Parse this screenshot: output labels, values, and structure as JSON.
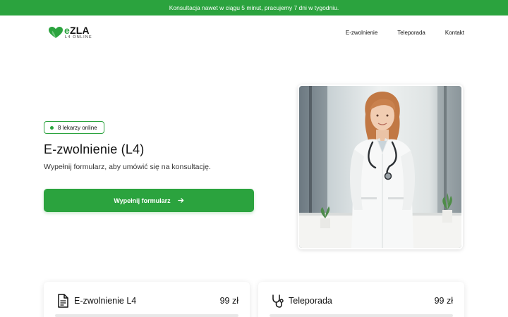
{
  "topbar": {
    "text": "Konsultacja nawet w ciągu 5 minut, pracujemy 7 dni w tygodniu."
  },
  "logo": {
    "prefix": "e",
    "main": "ZLA",
    "sub": "L4 ONLINE",
    "icon": "heart-logo-icon"
  },
  "nav": {
    "items": [
      "E-zwolnienie",
      "Teleporada",
      "Kontakt"
    ]
  },
  "hero": {
    "badge": "8 lekarzy online",
    "title": "E-zwolnienie (L4)",
    "subtitle": "Wypełnij formularz, aby umówić się na konsultację.",
    "cta": "Wypełnij formularz",
    "image": "doctor-photo"
  },
  "cards": [
    {
      "title": "E-zwolnienie L4",
      "price": "99 zł",
      "icon": "document-icon"
    },
    {
      "title": "Teleporada",
      "price": "99 zł",
      "icon": "stethoscope-icon"
    }
  ],
  "colors": {
    "accent": "#2ba33e",
    "text": "#111111",
    "background": "#ffffff"
  }
}
